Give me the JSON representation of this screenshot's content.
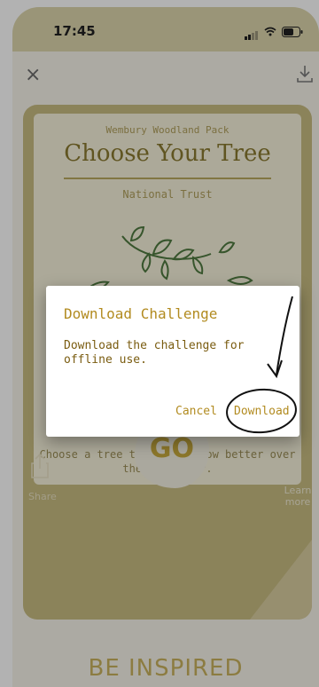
{
  "status_bar": {
    "time": "17:45"
  },
  "header": {
    "close_icon": "close-icon",
    "download_icon": "download-icon"
  },
  "card": {
    "pack_name": "Wembury Woodland Pack",
    "title": "Choose Your Tree",
    "organisation": "National Trust",
    "instruction": "Choose a tree to get to know better over the next year."
  },
  "actions": {
    "go_label": "GO",
    "share_label": "Share",
    "learn_label": "Learn more"
  },
  "section": {
    "heading": "BE INSPIRED"
  },
  "dialog": {
    "title": "Download Challenge",
    "message": "Download the challenge for\noffline use.",
    "cancel_label": "Cancel",
    "download_label": "Download"
  },
  "colors": {
    "accent_gold": "#b28b20",
    "card_olive": "#c8bc82",
    "status_bar": "#ddd6ad"
  }
}
